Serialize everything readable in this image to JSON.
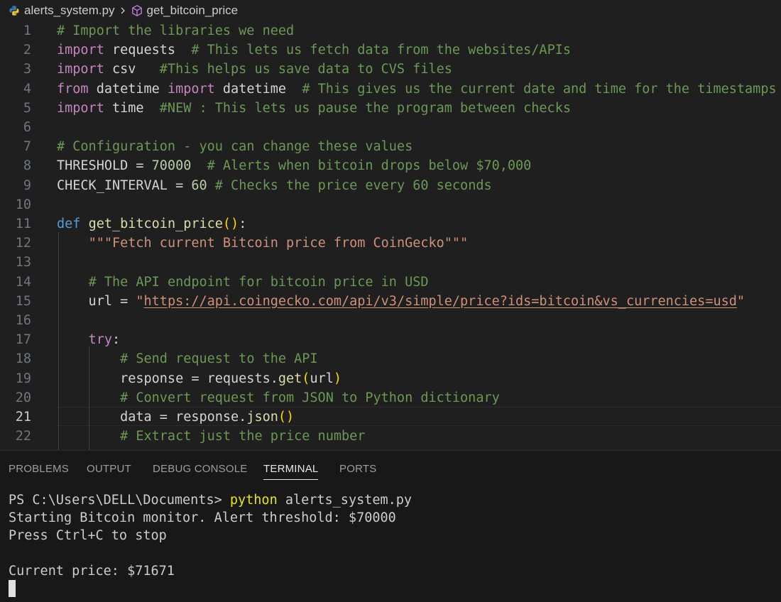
{
  "breadcrumb": {
    "file": "alerts_system.py",
    "symbol": "get_bitcoin_price"
  },
  "editor": {
    "active_line": 21,
    "lines": [
      {
        "no": "1",
        "t": [
          [
            "cm",
            "# Import the libraries we need"
          ]
        ]
      },
      {
        "no": "2",
        "t": [
          [
            "kw2",
            "import"
          ],
          [
            "pl",
            " requests  "
          ],
          [
            "cm",
            "# This lets us fetch data from the websites/APIs"
          ]
        ]
      },
      {
        "no": "3",
        "t": [
          [
            "kw2",
            "import"
          ],
          [
            "pl",
            " csv   "
          ],
          [
            "cm",
            "#This helps us save data to CVS files"
          ]
        ]
      },
      {
        "no": "4",
        "t": [
          [
            "kw2",
            "from"
          ],
          [
            "pl",
            " datetime "
          ],
          [
            "kw2",
            "import"
          ],
          [
            "pl",
            " datetime  "
          ],
          [
            "cm",
            "# This gives us the current date and time for the timestamps"
          ]
        ]
      },
      {
        "no": "5",
        "t": [
          [
            "kw2",
            "import"
          ],
          [
            "pl",
            " time  "
          ],
          [
            "cm",
            "#NEW : This lets us pause the program between checks"
          ]
        ]
      },
      {
        "no": "6",
        "t": []
      },
      {
        "no": "7",
        "t": [
          [
            "cm",
            "# Configuration - you can change these values"
          ]
        ]
      },
      {
        "no": "8",
        "t": [
          [
            "pl",
            "THRESHOLD = "
          ],
          [
            "num",
            "70000"
          ],
          [
            "pl",
            "  "
          ],
          [
            "cm",
            "# Alerts when bitcoin drops below $70,000"
          ]
        ]
      },
      {
        "no": "9",
        "t": [
          [
            "pl",
            "CHECK_INTERVAL = "
          ],
          [
            "num",
            "60"
          ],
          [
            "pl",
            " "
          ],
          [
            "cm",
            "# Checks the price every 60 seconds"
          ]
        ]
      },
      {
        "no": "10",
        "t": []
      },
      {
        "no": "11",
        "t": [
          [
            "kw",
            "def"
          ],
          [
            "pl",
            " "
          ],
          [
            "fn",
            "get_bitcoin_price"
          ],
          [
            "par",
            "()"
          ],
          [
            "pl",
            ":"
          ]
        ]
      },
      {
        "no": "12",
        "t": [
          [
            "pl",
            "    "
          ],
          [
            "st",
            "\"\"\"Fetch current Bitcoin price from CoinGecko\"\"\""
          ]
        ]
      },
      {
        "no": "13",
        "t": []
      },
      {
        "no": "14",
        "t": [
          [
            "pl",
            "    "
          ],
          [
            "cm",
            "# The API endpoint for bitcoin price in USD"
          ]
        ]
      },
      {
        "no": "15",
        "t": [
          [
            "pl",
            "    url = "
          ],
          [
            "st",
            "\""
          ],
          [
            "url",
            "https://api.coingecko.com/api/v3/simple/price?ids=bitcoin&vs_currencies=usd"
          ],
          [
            "st",
            "\""
          ]
        ]
      },
      {
        "no": "16",
        "t": []
      },
      {
        "no": "17",
        "t": [
          [
            "pl",
            "    "
          ],
          [
            "kw2",
            "try"
          ],
          [
            "pl",
            ":"
          ]
        ]
      },
      {
        "no": "18",
        "t": [
          [
            "pl",
            "        "
          ],
          [
            "cm",
            "# Send request to the API"
          ]
        ]
      },
      {
        "no": "19",
        "t": [
          [
            "pl",
            "        response = requests."
          ],
          [
            "fn",
            "get"
          ],
          [
            "par",
            "("
          ],
          [
            "pl",
            "url"
          ],
          [
            "par",
            ")"
          ]
        ]
      },
      {
        "no": "20",
        "t": [
          [
            "pl",
            "        "
          ],
          [
            "cm",
            "# Convert request from JSON to Python dictionary"
          ]
        ]
      },
      {
        "no": "21",
        "t": [
          [
            "pl",
            "        data = response."
          ],
          [
            "fn",
            "json"
          ],
          [
            "par",
            "()"
          ]
        ]
      },
      {
        "no": "22",
        "t": [
          [
            "pl",
            "        "
          ],
          [
            "cm",
            "# Extract just the price number"
          ]
        ]
      }
    ]
  },
  "panel": {
    "tabs": [
      {
        "label": "PROBLEMS",
        "active": false
      },
      {
        "label": "OUTPUT",
        "active": false
      },
      {
        "label": "DEBUG CONSOLE",
        "active": false
      },
      {
        "label": "TERMINAL",
        "active": true
      },
      {
        "label": "PORTS",
        "active": false
      }
    ],
    "terminal": {
      "prompt": "PS C:\\Users\\DELL\\Documents> ",
      "command": "python",
      "args": " alerts_system.py",
      "line1": "Starting Bitcoin monitor. Alert threshold: $70000",
      "line2": "Press Ctrl+C to stop",
      "line3": "",
      "line4": "Current price: $71671"
    }
  },
  "colors": {
    "background": "#1f1f1f",
    "panel_background": "#181818",
    "keyword": "#569cd6",
    "control_keyword": "#c586c0",
    "comment": "#6a9955",
    "string": "#ce9178",
    "function": "#dcdcaa",
    "number": "#b5cea8",
    "bracket": "#ffd700",
    "terminal_command": "#e5e510"
  }
}
